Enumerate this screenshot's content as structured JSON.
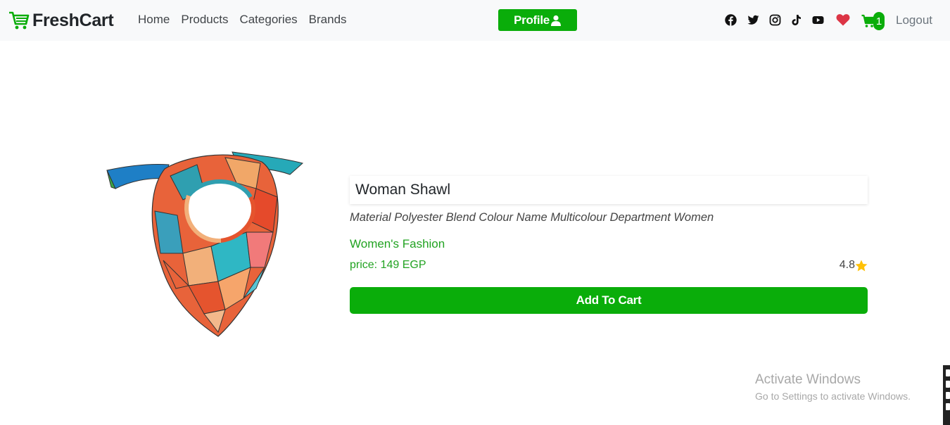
{
  "navbar": {
    "brand": "FreshCart",
    "links": [
      "Home",
      "Products",
      "Categories",
      "Brands"
    ],
    "profile_label": "Profile",
    "social_icons": [
      "facebook-icon",
      "twitter-icon",
      "instagram-icon",
      "tiktok-icon",
      "youtube-icon"
    ],
    "wishlist_icon": "heart-icon",
    "cart_count": "1",
    "logout_label": "Logout"
  },
  "product": {
    "title": "Woman Shawl",
    "description": "Material Polyester Blend Colour Name Multicolour Department Women",
    "category": "Women's Fashion",
    "price": "price: 149 EGP",
    "rating": "4.8",
    "add_to_cart_label": "Add To Cart"
  },
  "watermark": {
    "title": "Activate Windows",
    "subtitle": "Go to Settings to activate Windows."
  },
  "colors": {
    "brand_green": "#0aad0a",
    "text_green": "#22a322",
    "heart_red": "#dc3545",
    "star_gold": "#ffc107"
  }
}
